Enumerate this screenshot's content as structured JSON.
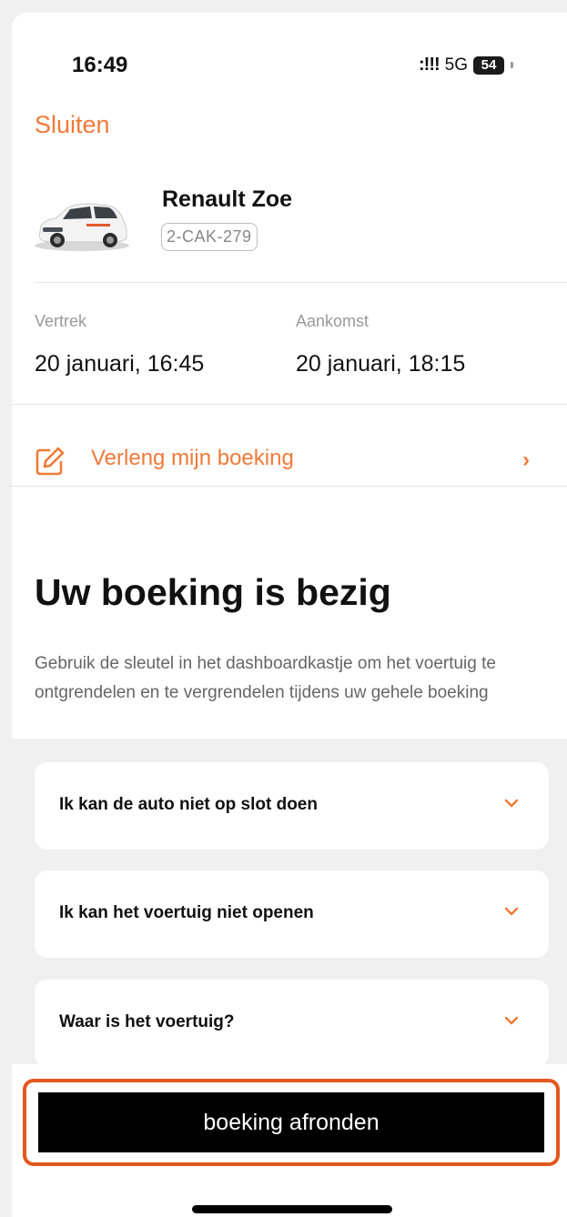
{
  "status_bar": {
    "time": "16:49",
    "signal": ":!!!",
    "network": "5G",
    "battery": "54"
  },
  "header": {
    "close_label": "Sluiten"
  },
  "vehicle": {
    "name": "Renault Zoe",
    "plate": "2-CAK-279"
  },
  "trip": {
    "departure_label": "Vertrek",
    "departure_value": "20 januari, 16:45",
    "arrival_label": "Aankomst",
    "arrival_value": "20 januari, 18:15"
  },
  "extend": {
    "label": "Verleng mijn boeking",
    "icon": "edit-icon"
  },
  "status": {
    "headline": "Uw boeking is bezig",
    "description": "Gebruik de sleutel in het dashboardkastje om het voertuig te ontgrendelen en te vergrendelen tijdens uw gehele boeking"
  },
  "faq": [
    {
      "title": "Ik kan de auto niet op slot doen"
    },
    {
      "title": "Ik kan het voertuig niet openen"
    },
    {
      "title": "Waar is het voertuig?"
    }
  ],
  "cta": {
    "label": "boeking afronden"
  },
  "colors": {
    "accent": "#f07a3a",
    "highlight": "#e2581e",
    "button": "#000000"
  }
}
